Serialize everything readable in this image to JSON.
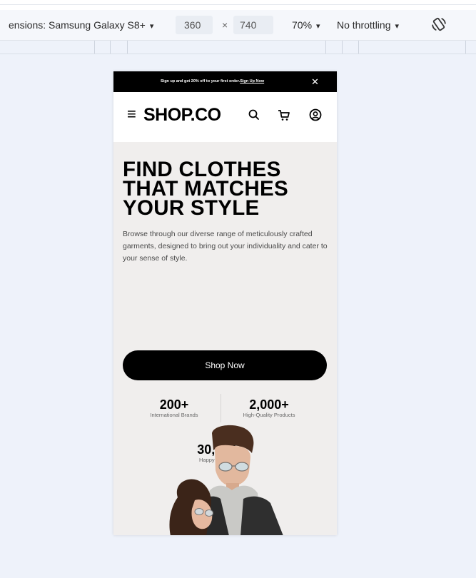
{
  "devtools": {
    "dimensions_label": "ensions: Samsung Galaxy S8+",
    "width": "360",
    "times": "×",
    "height": "740",
    "zoom": "70%",
    "throttling": "No throttling",
    "caret": "▾"
  },
  "site": {
    "promo": {
      "text": "Sign up and get 20% off to your first order.",
      "link": "Sign Up Now",
      "close": "✕"
    },
    "menu_icon": "≡",
    "logo": "SHOP.CO",
    "hero": {
      "title_lines": [
        "FIND CLOTHES",
        "THAT MATCHES",
        "YOUR STYLE"
      ],
      "description": "Browse through our diverse range of meticulously crafted garments, designed to bring out your individuality and cater to your sense of style.",
      "cta": "Shop Now"
    },
    "stats": [
      {
        "value": "200+",
        "label": "International Brands"
      },
      {
        "value": "2,000+",
        "label": "High-Quality Products"
      },
      {
        "value": "30,000+",
        "label": "Happy Customers"
      }
    ]
  },
  "icons": {
    "rotate": "rotate-icon",
    "search": "search-icon",
    "cart": "cart-icon",
    "account": "account-icon"
  },
  "colors": {
    "background": "#eef2fa",
    "hero_background": "#f0eeed",
    "primary": "#000000"
  }
}
